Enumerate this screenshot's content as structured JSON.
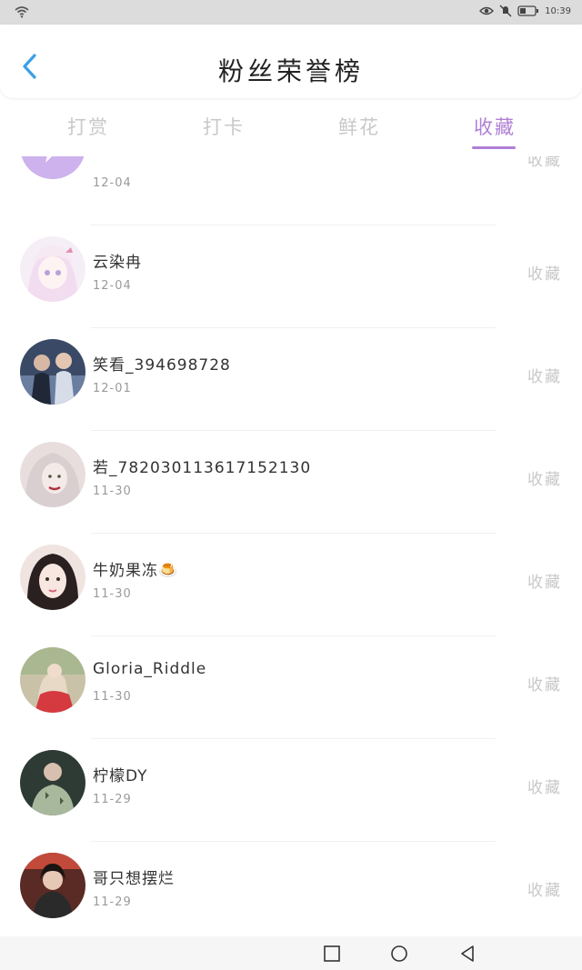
{
  "status_bar": {
    "time": "10:39",
    "icons": [
      "wifi-icon",
      "eye-icon",
      "mute-icon",
      "battery-icon"
    ]
  },
  "header": {
    "title": "粉丝荣誉榜",
    "back_icon": "chevron-left-icon"
  },
  "tabs": [
    {
      "label": "打赏",
      "active": false
    },
    {
      "label": "打卡",
      "active": false
    },
    {
      "label": "鲜花",
      "active": false
    },
    {
      "label": "收藏",
      "active": true
    }
  ],
  "colors": {
    "accent": "#b07fd6",
    "inactive_tab": "#c9c9c9",
    "date_text": "#9a9a9a"
  },
  "list": [
    {
      "name": "",
      "date": "12-04",
      "action": "收藏"
    },
    {
      "name": "云染冉",
      "date": "12-04",
      "action": "收藏"
    },
    {
      "name": "笑看_394698728",
      "date": "12-01",
      "action": "收藏"
    },
    {
      "name": "若_782030113617152130",
      "date": "11-30",
      "action": "收藏"
    },
    {
      "name": "牛奶果冻🍮",
      "date": "11-30",
      "action": "收藏"
    },
    {
      "name": "Gloria_Riddle",
      "date": "11-30",
      "action": "收藏"
    },
    {
      "name": "柠檬DY",
      "date": "11-29",
      "action": "收藏"
    },
    {
      "name": "哥只想摆烂",
      "date": "11-29",
      "action": "收藏"
    }
  ],
  "navbar": {
    "icons": [
      "recent-apps-icon",
      "home-icon",
      "back-nav-icon"
    ]
  }
}
